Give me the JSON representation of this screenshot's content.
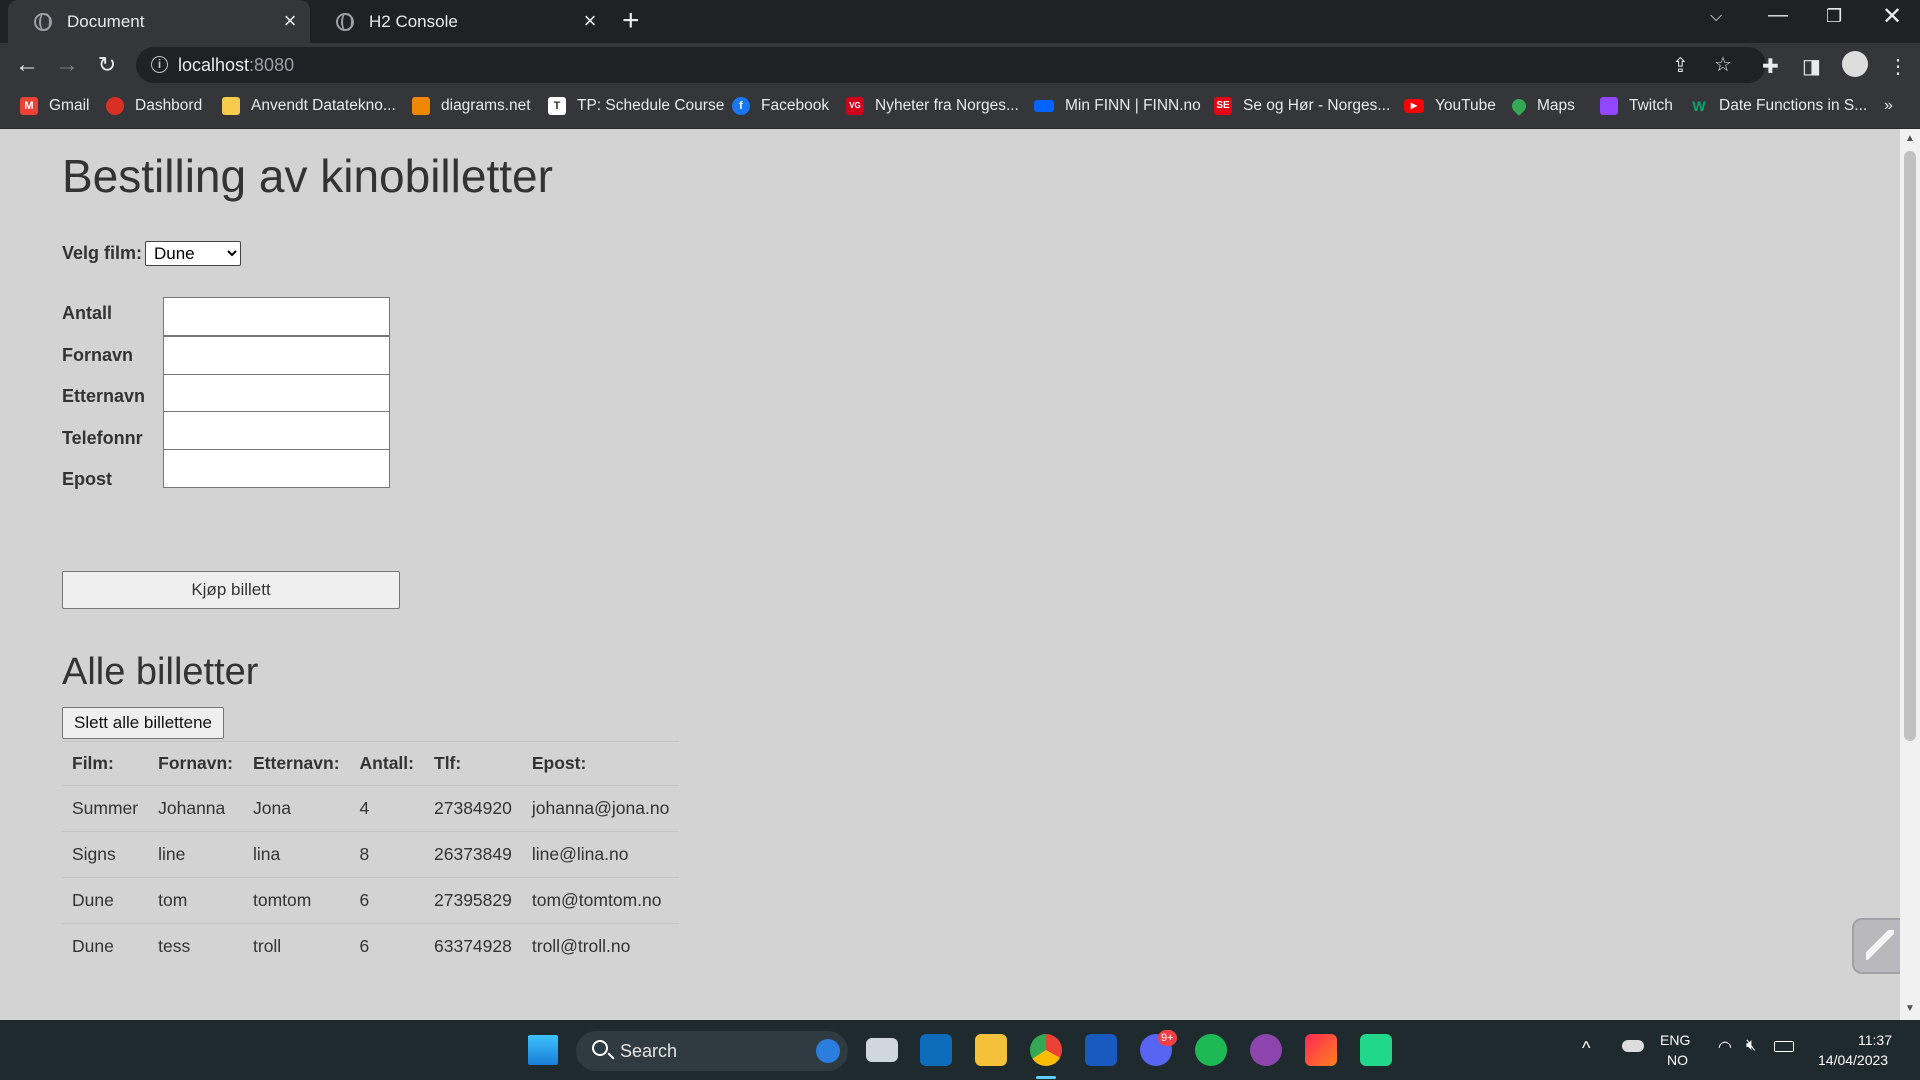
{
  "browser": {
    "tabs": [
      {
        "label": "Document",
        "active": true
      },
      {
        "label": "H2 Console",
        "active": false
      }
    ],
    "url_host": "localhost",
    "url_port": ":8080",
    "bookmarks": [
      {
        "label": "Gmail",
        "icon": "gmail-icon",
        "color": "#ea4335"
      },
      {
        "label": "Dashbord",
        "icon": "dashboard-icon",
        "color": "#d93025"
      },
      {
        "label": "Anvendt Datatekno...",
        "icon": "folder-icon",
        "color": "#f7cb4d"
      },
      {
        "label": "diagrams.net",
        "icon": "diagrams-icon",
        "color": "#f08705"
      },
      {
        "label": "TP: Schedule Course",
        "icon": "tp-icon",
        "color": "#ffffff"
      },
      {
        "label": "Facebook",
        "icon": "facebook-icon",
        "color": "#1877f2"
      },
      {
        "label": "Nyheter fra Norges...",
        "icon": "vg-icon",
        "color": "#d0021b"
      },
      {
        "label": "Min FINN | FINN.no",
        "icon": "finn-icon",
        "color": "#0063fb"
      },
      {
        "label": "Se og Hør - Norges...",
        "icon": "seoghor-icon",
        "color": "#e30613"
      },
      {
        "label": "YouTube",
        "icon": "youtube-icon",
        "color": "#ff0000"
      },
      {
        "label": "Maps",
        "icon": "maps-icon",
        "color": "#34a853"
      },
      {
        "label": "Twitch",
        "icon": "twitch-icon",
        "color": "#9146ff"
      },
      {
        "label": "Date Functions in S...",
        "icon": "w3schools-icon",
        "color": "#04aa6d"
      }
    ]
  },
  "form": {
    "title": "Bestilling av kinobilletter",
    "film_label": "Velg film:",
    "film_selected": "Dune",
    "fields": {
      "antall": "Antall",
      "fornavn": "Fornavn",
      "etternavn": "Etternavn",
      "telefonnr": "Telefonnr",
      "epost": "Epost"
    },
    "buy_label": "Kjøp billett"
  },
  "tickets": {
    "title": "Alle billetter",
    "delete_label": "Slett alle billettene",
    "headers": [
      "Film:",
      "Fornavn:",
      "Etternavn:",
      "Antall:",
      "Tlf:",
      "Epost:"
    ],
    "rows": [
      [
        "Summer",
        "Johanna",
        "Jona",
        "4",
        "27384920",
        "johanna@jona.no"
      ],
      [
        "Signs",
        "line",
        "lina",
        "8",
        "26373849",
        "line@lina.no"
      ],
      [
        "Dune",
        "tom",
        "tomtom",
        "6",
        "27395829",
        "tom@tomtom.no"
      ],
      [
        "Dune",
        "tess",
        "troll",
        "6",
        "63374928",
        "troll@troll.no"
      ]
    ]
  },
  "taskbar": {
    "search_label": "Search",
    "lang_top": "ENG",
    "lang_bottom": "NO",
    "time": "11:37",
    "date": "14/04/2023",
    "discord_badge": "9+"
  }
}
